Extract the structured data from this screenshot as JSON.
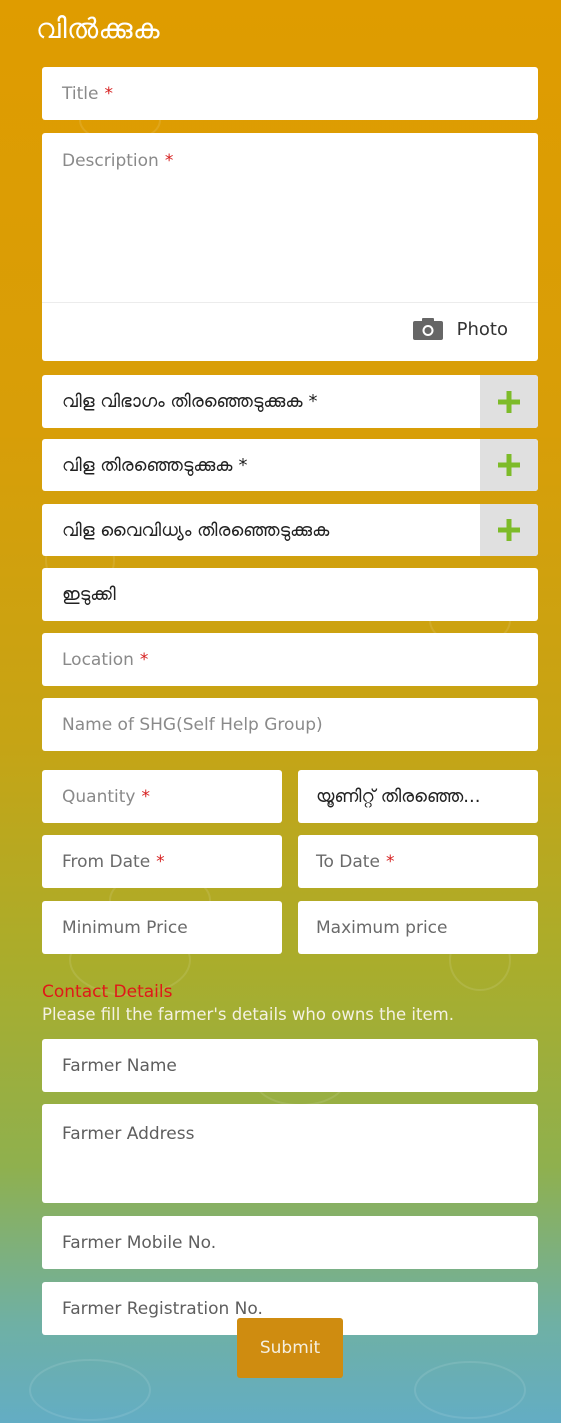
{
  "header": {
    "title": "വിൽക്കുക"
  },
  "form": {
    "title_placeholder": "Title",
    "description_placeholder": "Description",
    "photo_label": "Photo",
    "crop_category_label": "വിള വിഭാഗം തിരഞ്ഞെടുക്കുക",
    "crop_label": "വിള തിരഞ്ഞെടുക്കുക",
    "crop_variety_label": "വിള വൈവിധ്യം തിരഞ്ഞെടുക്കുക",
    "district_value": "ഇടുക്കി",
    "location_placeholder": "Location",
    "shg_placeholder": "Name of SHG(Self Help Group)",
    "quantity_placeholder": "Quantity",
    "unit_label": "യൂണിറ്റ് തിരഞ്ഞെ...",
    "from_date_label": "From Date",
    "to_date_label": "To Date",
    "min_price_placeholder": "Minimum Price",
    "max_price_placeholder": "Maximum price",
    "required_mark": "*"
  },
  "contact": {
    "heading": "Contact Details",
    "note": "Please fill the farmer's details who owns the item.",
    "farmer_name_placeholder": "Farmer Name",
    "farmer_address_placeholder": "Farmer Address",
    "farmer_mobile_placeholder": "Farmer Mobile No.",
    "farmer_registration_placeholder": "Farmer Registration No."
  },
  "actions": {
    "submit_label": "Submit"
  },
  "icons": {
    "plus": "plus-icon",
    "camera": "camera-icon"
  },
  "colors": {
    "accent_green": "#7dbb29",
    "required_red": "#d62020",
    "submit_bg": "#cf8c10"
  }
}
